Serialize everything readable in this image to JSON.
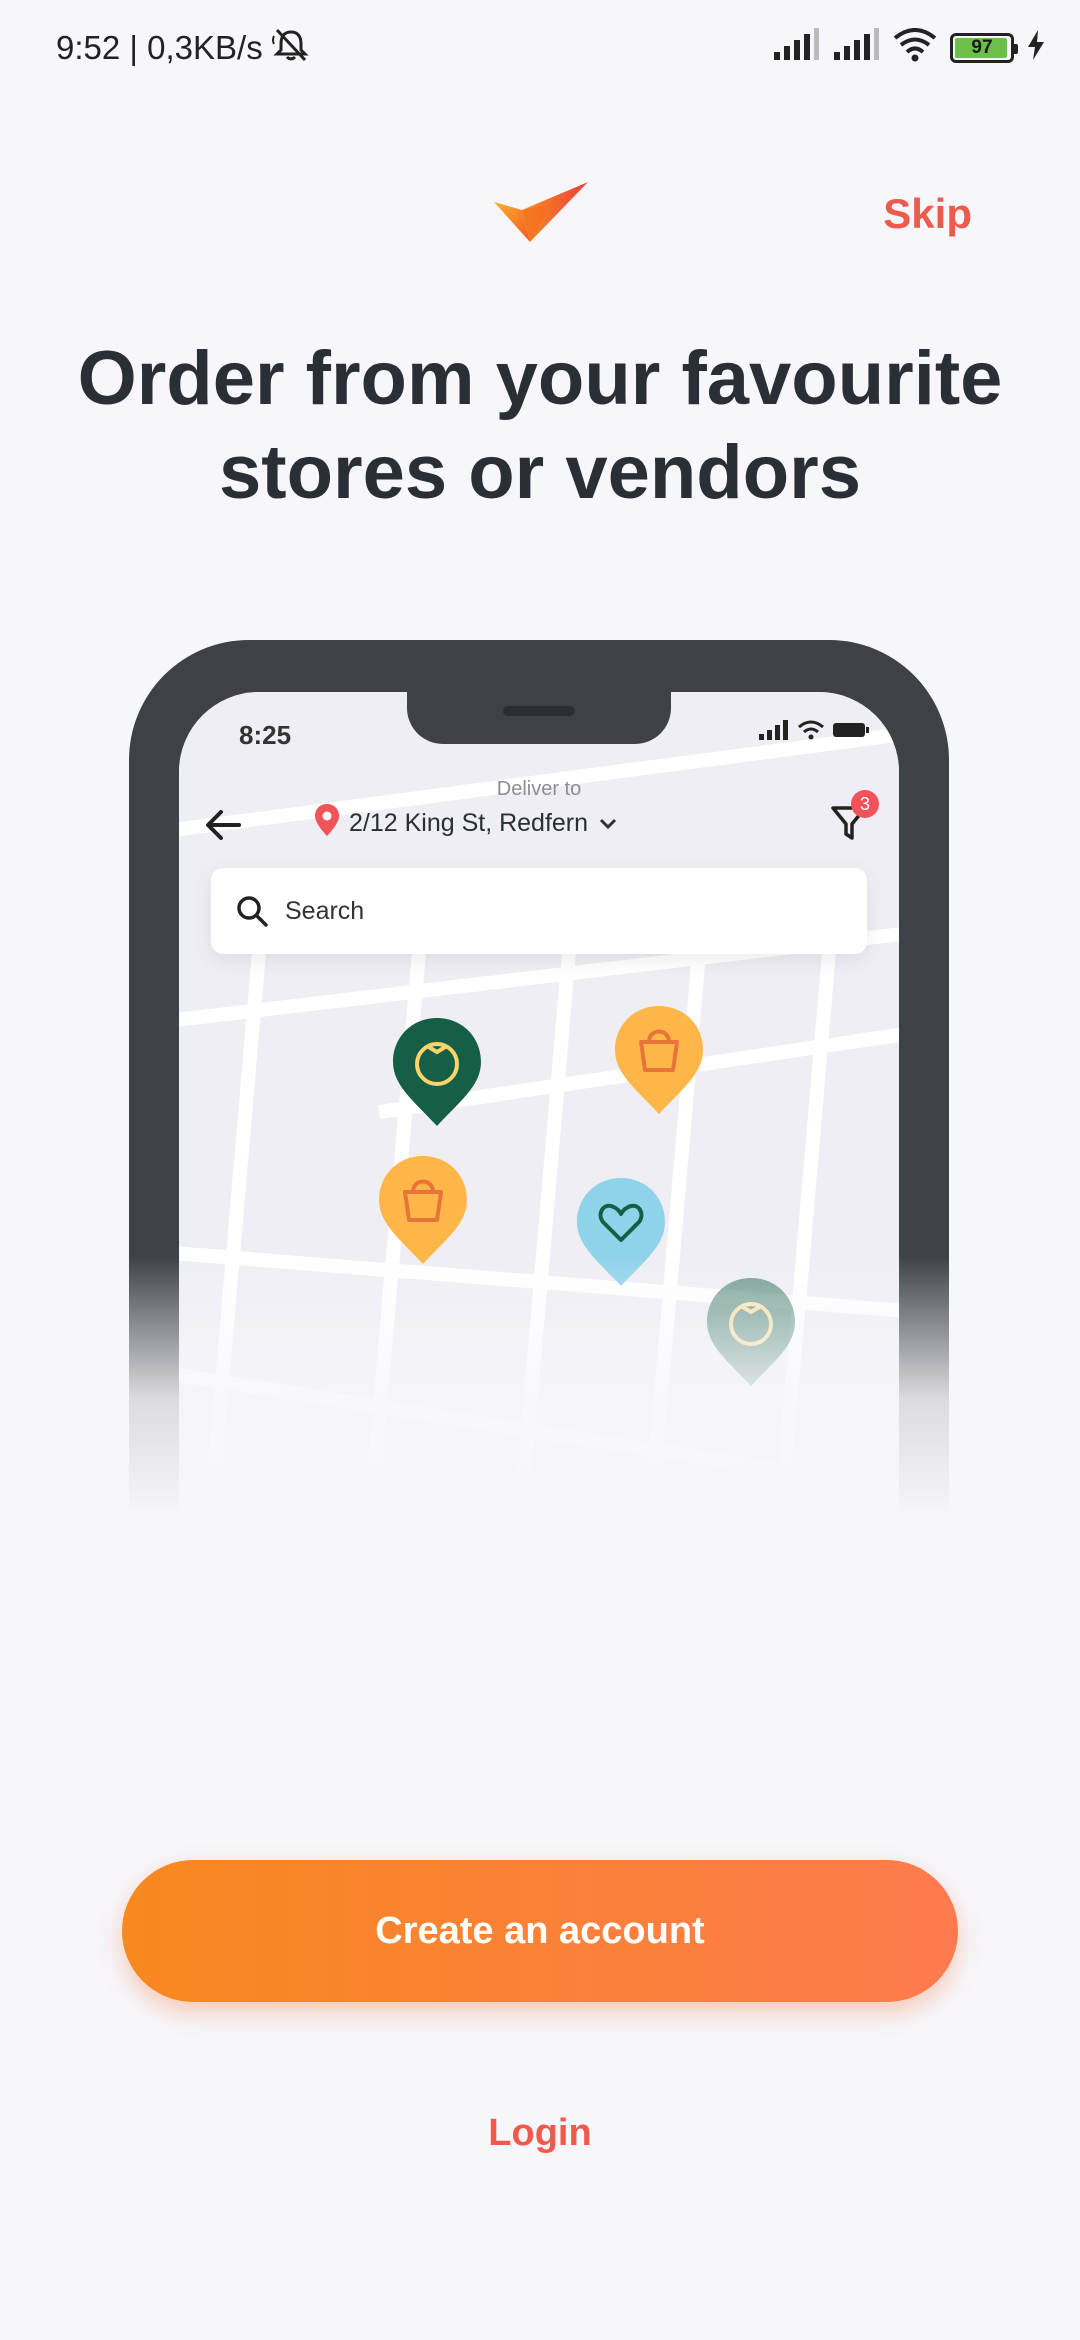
{
  "status_bar": {
    "time": "9:52 | 0,3KB/s",
    "battery": "97",
    "battery_level": 0.97,
    "icons": [
      "alarm-off-icon",
      "signal-icon",
      "signal-icon",
      "wifi-icon",
      "battery-icon",
      "charging-icon"
    ]
  },
  "header": {
    "logo": "brand-logo-icon",
    "skip_label": "Skip"
  },
  "headline": {
    "line1": "Order from your favourite",
    "line2": "stores or vendors"
  },
  "illustration": {
    "time": "8:25",
    "deliver_to_label": "Deliver to",
    "address": "2/12 King St, Redfern",
    "filter_badge": "3",
    "search_placeholder": "Search",
    "pins": [
      {
        "type": "tomato",
        "color": "#145F46"
      },
      {
        "type": "bag",
        "color": "#FFB649"
      },
      {
        "type": "bag",
        "color": "#FFB649"
      },
      {
        "type": "heart",
        "color": "#8FD3EA"
      },
      {
        "type": "tomato",
        "color": "#7FA894"
      }
    ]
  },
  "actions": {
    "create_account_label": "Create an account",
    "login_label": "Login"
  },
  "colors": {
    "accent": "#EE5A4C",
    "cta_start": "#F7891F",
    "cta_end": "#FF7A4E",
    "background": "#F7F6FA",
    "text": "#2A2F36"
  }
}
